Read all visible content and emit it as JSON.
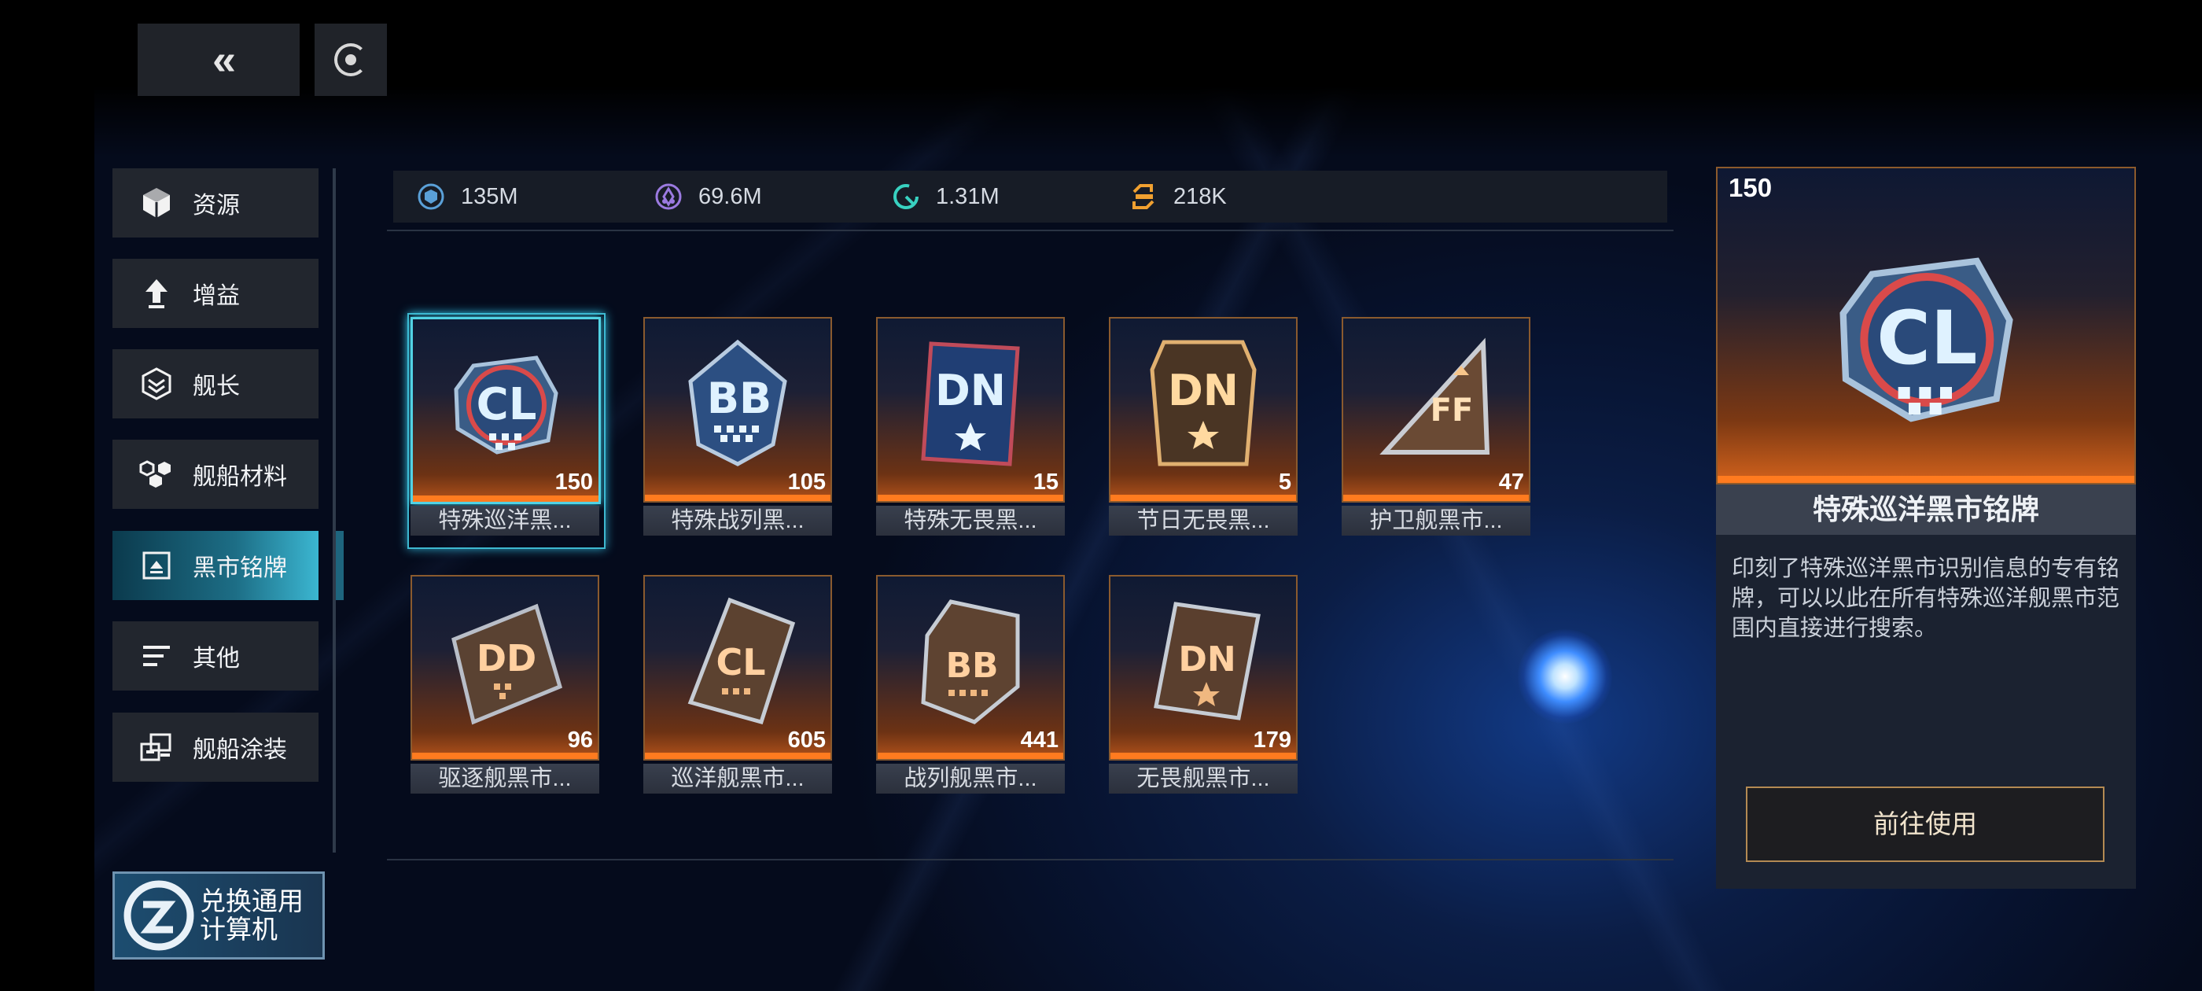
{
  "nav": {
    "back_icon": "double-chevron-left-icon",
    "refresh_icon": "refresh-icon",
    "back_glyph": "«"
  },
  "sidebar": {
    "items": [
      {
        "label": "资源",
        "icon": "cube-icon"
      },
      {
        "label": "增益",
        "icon": "up-arrow-icon"
      },
      {
        "label": "舰长",
        "icon": "hexagon-badge-icon"
      },
      {
        "label": "舰船材料",
        "icon": "hex-cluster-icon"
      },
      {
        "label": "黑市铭牌",
        "icon": "badge-frame-icon",
        "active": true
      },
      {
        "label": "其他",
        "icon": "list-lines-icon"
      },
      {
        "label": "舰船涂装",
        "icon": "paint-ship-icon"
      }
    ],
    "exchange": {
      "line1": "兑换通用",
      "line2": "计算机",
      "icon": "zl-logo-icon"
    }
  },
  "resources": [
    {
      "value": "135M",
      "icon": "metal-icon",
      "color": "#5aa0d8"
    },
    {
      "value": "69.6M",
      "icon": "crystal-icon",
      "color": "#9b7ae0"
    },
    {
      "value": "1.31M",
      "icon": "deuterium-icon",
      "color": "#38d1c0"
    },
    {
      "value": "218K",
      "icon": "credit-icon",
      "color": "#f0a030"
    }
  ],
  "items": [
    {
      "name": "特殊巡洋黑...",
      "count": "150",
      "code": "CL",
      "style": "special",
      "selected": true
    },
    {
      "name": "特殊战列黑...",
      "count": "105",
      "code": "BB",
      "style": "special"
    },
    {
      "name": "特殊无畏黑...",
      "count": "15",
      "code": "DN",
      "style": "special"
    },
    {
      "name": "节日无畏黑...",
      "count": "5",
      "code": "DN",
      "style": "festival"
    },
    {
      "name": "护卫舰黑市...",
      "count": "47",
      "code": "FF",
      "style": "normal"
    },
    {
      "name": "驱逐舰黑市...",
      "count": "96",
      "code": "DD",
      "style": "normal"
    },
    {
      "name": "巡洋舰黑市...",
      "count": "605",
      "code": "CL",
      "style": "normal"
    },
    {
      "name": "战列舰黑市...",
      "count": "441",
      "code": "BB",
      "style": "normal"
    },
    {
      "name": "无畏舰黑市...",
      "count": "179",
      "code": "DN",
      "style": "normal"
    }
  ],
  "detail": {
    "count": "150",
    "code": "CL",
    "title": "特殊巡洋黑市铭牌",
    "description": "印刻了特殊巡洋黑市识别信息的专有铭牌，可以以此在所有特殊巡洋舰黑市范围内直接进行搜索。",
    "action_label": "前往使用"
  },
  "colors": {
    "accent_cyan": "#3bb6d1",
    "rarity_orange": "#ff7b1f",
    "button_gold": "#b38a53"
  }
}
